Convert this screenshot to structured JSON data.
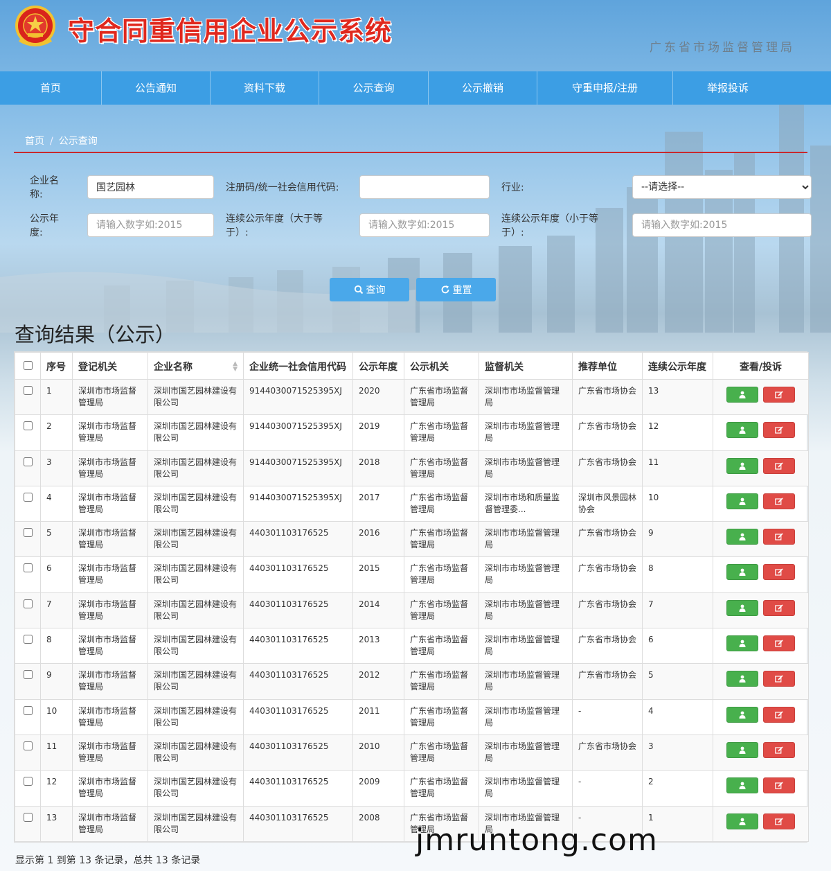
{
  "site": {
    "title": "守合同重信用企业公示系统",
    "agency": "广东省市场监督管理局"
  },
  "nav": [
    "首页",
    "公告通知",
    "资料下载",
    "公示查询",
    "公示撤销",
    "守重申报/注册",
    "举报投诉"
  ],
  "breadcrumb": {
    "home": "首页",
    "separator": "/",
    "current": "公示查询"
  },
  "form": {
    "company_name": {
      "label": "企业名称:",
      "value": "国艺园林"
    },
    "reg_code": {
      "label": "注册码/统一社会信用代码:",
      "value": ""
    },
    "industry": {
      "label": "行业:",
      "selected": "--请选择--"
    },
    "pub_year": {
      "label": "公示年度:",
      "placeholder": "请输入数字如:2015"
    },
    "years_gt": {
      "label": "连续公示年度（大于等于）:",
      "placeholder": "请输入数字如:2015"
    },
    "years_lt": {
      "label": "连续公示年度（小于等于）:",
      "placeholder": "请输入数字如:2015"
    },
    "search_label": "查询",
    "reset_label": "重置"
  },
  "results_title": "查询结果（公示）",
  "table": {
    "headers": [
      "序号",
      "登记机关",
      "企业名称",
      "企业统一社会信用代码",
      "公示年度",
      "公示机关",
      "监督机关",
      "推荐单位",
      "连续公示年度",
      "查看/投诉"
    ],
    "rows": [
      [
        "1",
        "深圳市市场监督管理局",
        "深圳市国艺园林建设有限公司",
        "9144030071525395XJ",
        "2020",
        "广东省市场监督管理局",
        "深圳市市场监督管理局",
        "广东省市场协会",
        "13"
      ],
      [
        "2",
        "深圳市市场监督管理局",
        "深圳市国艺园林建设有限公司",
        "9144030071525395XJ",
        "2019",
        "广东省市场监督管理局",
        "深圳市市场监督管理局",
        "广东省市场协会",
        "12"
      ],
      [
        "3",
        "深圳市市场监督管理局",
        "深圳市国艺园林建设有限公司",
        "9144030071525395XJ",
        "2018",
        "广东省市场监督管理局",
        "深圳市市场监督管理局",
        "广东省市场协会",
        "11"
      ],
      [
        "4",
        "深圳市市场监督管理局",
        "深圳市国艺园林建设有限公司",
        "9144030071525395XJ",
        "2017",
        "广东省市场监督管理局",
        "深圳市市场和质量监督管理委...",
        "深圳市风景园林协会",
        "10"
      ],
      [
        "5",
        "深圳市市场监督管理局",
        "深圳市国艺园林建设有限公司",
        "440301103176525",
        "2016",
        "广东省市场监督管理局",
        "深圳市市场监督管理局",
        "广东省市场协会",
        "9"
      ],
      [
        "6",
        "深圳市市场监督管理局",
        "深圳市国艺园林建设有限公司",
        "440301103176525",
        "2015",
        "广东省市场监督管理局",
        "深圳市市场监督管理局",
        "广东省市场协会",
        "8"
      ],
      [
        "7",
        "深圳市市场监督管理局",
        "深圳市国艺园林建设有限公司",
        "440301103176525",
        "2014",
        "广东省市场监督管理局",
        "深圳市市场监督管理局",
        "广东省市场协会",
        "7"
      ],
      [
        "8",
        "深圳市市场监督管理局",
        "深圳市国艺园林建设有限公司",
        "440301103176525",
        "2013",
        "广东省市场监督管理局",
        "深圳市市场监督管理局",
        "广东省市场协会",
        "6"
      ],
      [
        "9",
        "深圳市市场监督管理局",
        "深圳市国艺园林建设有限公司",
        "440301103176525",
        "2012",
        "广东省市场监督管理局",
        "深圳市市场监督管理局",
        "广东省市场协会",
        "5"
      ],
      [
        "10",
        "深圳市市场监督管理局",
        "深圳市国艺园林建设有限公司",
        "440301103176525",
        "2011",
        "广东省市场监督管理局",
        "深圳市市场监督管理局",
        "-",
        "4"
      ],
      [
        "11",
        "深圳市市场监督管理局",
        "深圳市国艺园林建设有限公司",
        "440301103176525",
        "2010",
        "广东省市场监督管理局",
        "深圳市市场监督管理局",
        "广东省市场协会",
        "3"
      ],
      [
        "12",
        "深圳市市场监督管理局",
        "深圳市国艺园林建设有限公司",
        "440301103176525",
        "2009",
        "广东省市场监督管理局",
        "深圳市市场监督管理局",
        "-",
        "2"
      ],
      [
        "13",
        "深圳市市场监督管理局",
        "深圳市国艺园林建设有限公司",
        "440301103176525",
        "2008",
        "广东省市场监督管理局",
        "深圳市市场监督管理局",
        "-",
        "1"
      ]
    ]
  },
  "footer": "显示第 1 到第 13 条记录，总共 13 条记录",
  "watermark": "jmruntong.com",
  "colors": {
    "nav": "#3c9ee4",
    "title": "#e0281e",
    "view_button": "#48b04d",
    "edit_button": "#e04b46",
    "divider": "#c8282c"
  },
  "icons": {
    "emblem": "national-emblem-icon",
    "search": "search-icon",
    "reset": "refresh-icon",
    "view": "user-icon",
    "edit": "edit-icon"
  }
}
